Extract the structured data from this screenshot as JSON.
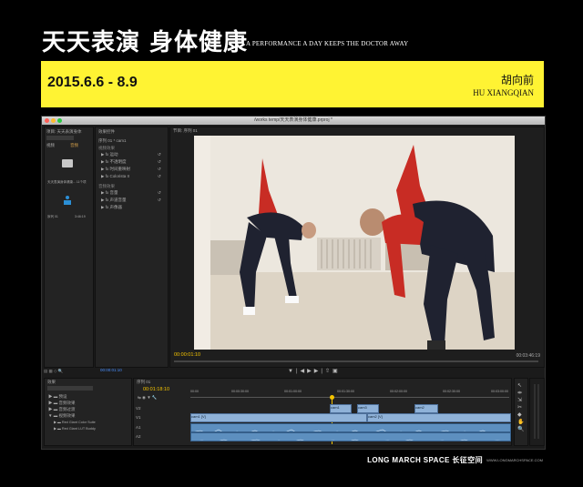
{
  "poster": {
    "title_zh": "天天表演 身体健康",
    "title_en": "A PERFORMANCE A DAY KEEPS THE DOCTOR AWAY",
    "dates": "2015.6.6 - 8.9",
    "artist_zh": "胡向前",
    "artist_en": "HU XIANGQIAN",
    "gallery": "LONG MARCH SPACE 长征空间",
    "website": "WWW.LONGMARCHSPACE.COM"
  },
  "app": {
    "window_title": "/works temp/天天表演身体健康.prproj *",
    "project_panel": {
      "tab": "项目: 天天表演身体",
      "items": [
        "视频",
        "音频"
      ],
      "bin_label": "天天表演身体健康... 11个项",
      "clip_name": "序列 01",
      "duration": "3:46:19"
    },
    "effects_panel": {
      "tab": "效果控件",
      "search": "序列 01 * cam1",
      "sections": [
        "视频效果",
        "音频效果"
      ],
      "video_effects": [
        "运动",
        "不透明度",
        "时间重映射",
        "Colorista II"
      ],
      "audio_effects": [
        "音量",
        "声道音量",
        "声像器"
      ],
      "timecode": "00:00:01:10"
    },
    "program": {
      "tab": "节目: 序列 01",
      "current_tc": "00:00:01:10",
      "total_tc": "00:03:46:19"
    },
    "media_panel": {
      "tab": "效果",
      "items": [
        "预设",
        "音频效果",
        "音频过渡",
        "视频效果",
        "Red Giant Color Suite",
        "Red Giant LUT Buddy"
      ]
    },
    "timeline": {
      "tab": "序列 01",
      "timecode": "00:01:18:10",
      "ruler": [
        "00:00",
        "00:00:30:00",
        "00:01:00:00",
        "00:01:30:00",
        "00:02:00:00",
        "00:02:30:00",
        "00:03:00:00"
      ],
      "tracks": [
        "V2",
        "V1",
        "A1",
        "A2"
      ],
      "clips": [
        "cam1",
        "cam3",
        "cam2",
        "cam1 [V]",
        "cam2 [V]"
      ]
    }
  }
}
